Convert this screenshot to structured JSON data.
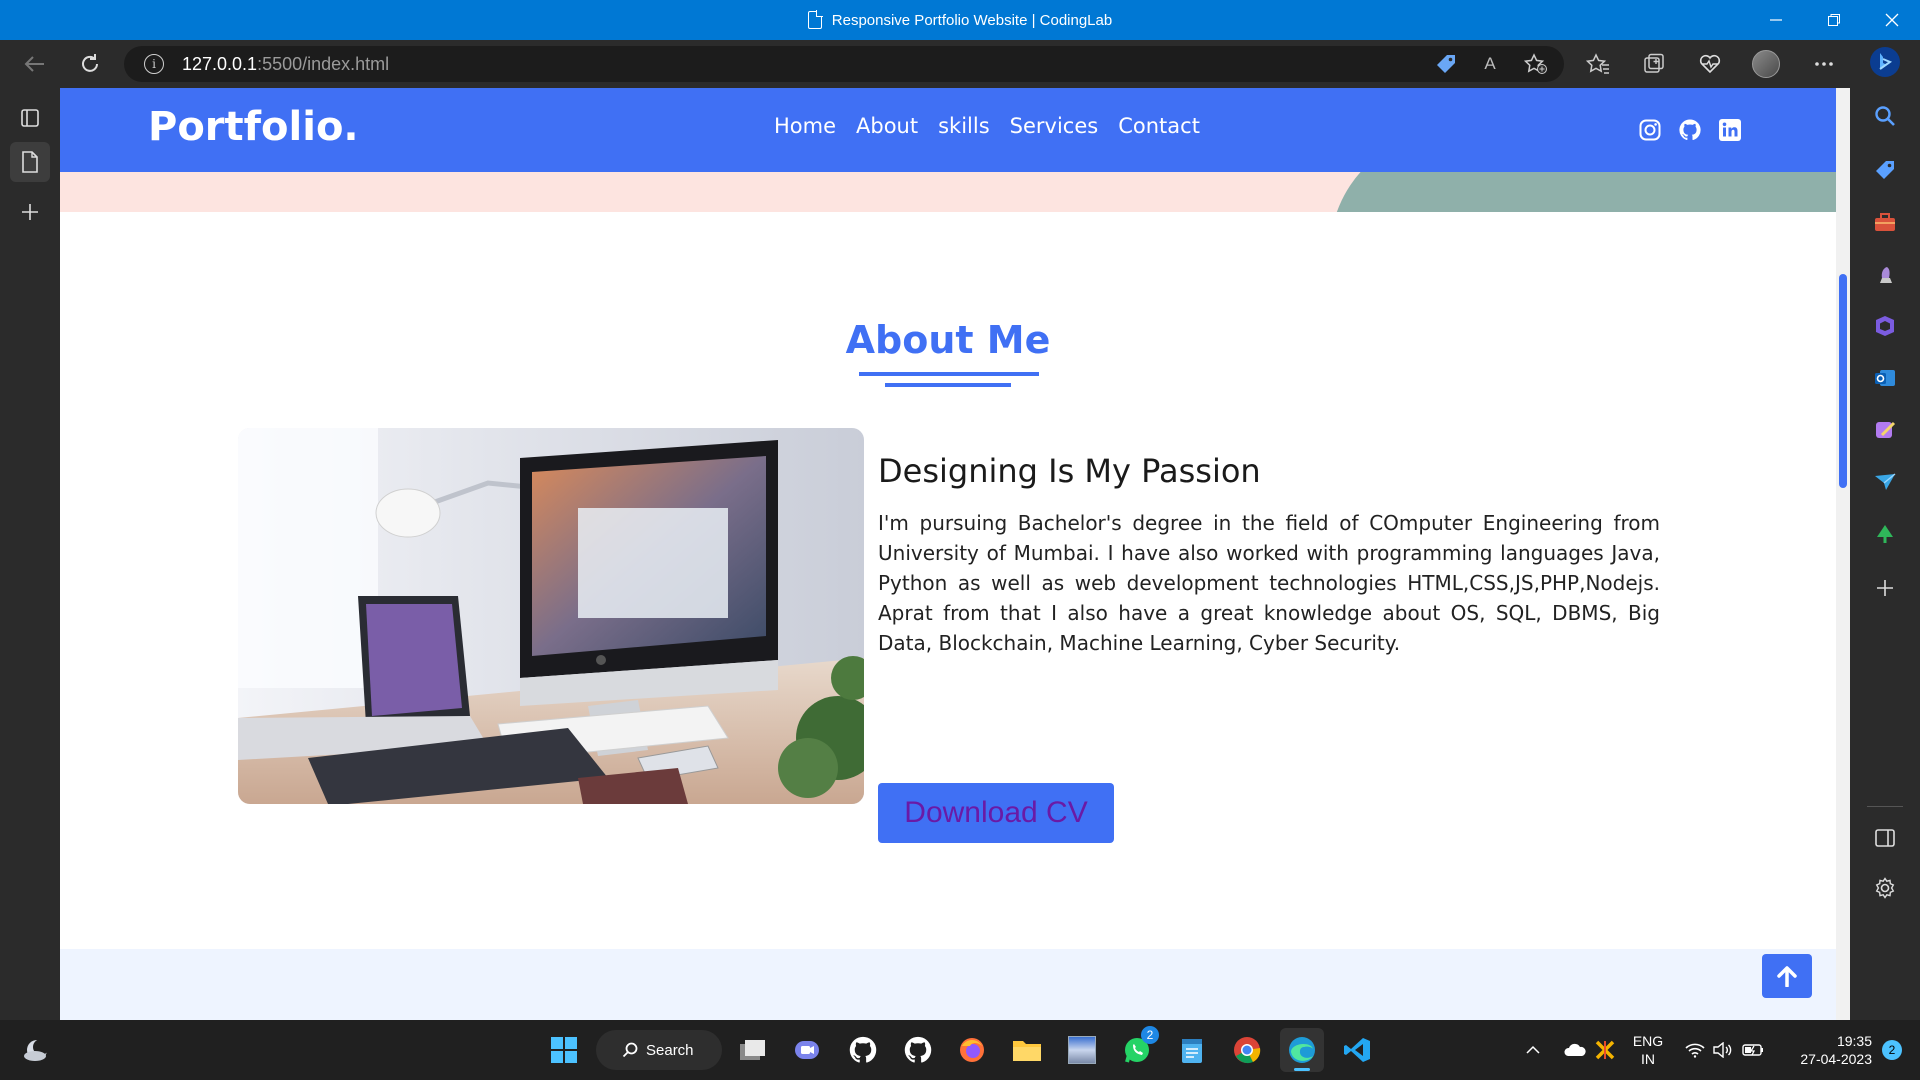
{
  "window": {
    "title": "Responsive Portfolio Website | CodingLab",
    "controls": [
      "minimize",
      "maximize",
      "close"
    ]
  },
  "browser": {
    "url_host": "127.0.0.1",
    "url_path": ":5500/index.html",
    "info_glyph": "i",
    "read_aloud_glyph": "A"
  },
  "site": {
    "logo": "Portfolio.",
    "nav": [
      "Home",
      "About",
      "skills",
      "Services",
      "Contact"
    ],
    "socials": [
      "instagram-icon",
      "github-icon",
      "linkedin-icon"
    ],
    "about": {
      "title": "About Me",
      "heading": "Designing Is My Passion",
      "paragraph": "I'm pursuing Bachelor's degree in the field of COmputer Engineering from University of Mumbai. I have also worked with programming languages Java, Python as well as web development technologies HTML,CSS,JS,PHP,Nodejs. Aprat from that I also have a great knowledge about OS, SQL, DBMS, Big Data, Blockchain, Machine Learning, Cyber Security.",
      "button": "Download CV"
    },
    "colors": {
      "primary": "#4070f4",
      "hero_pink": "#fde4e0",
      "hero_teal": "#8fb0aa",
      "section_bg": "#eef4ff"
    }
  },
  "taskbar": {
    "search_label": "Search",
    "whatsapp_badge": "2",
    "language": "ENG",
    "region": "IN",
    "time": "19:35",
    "date": "27-04-2023",
    "notification_count": "2"
  }
}
